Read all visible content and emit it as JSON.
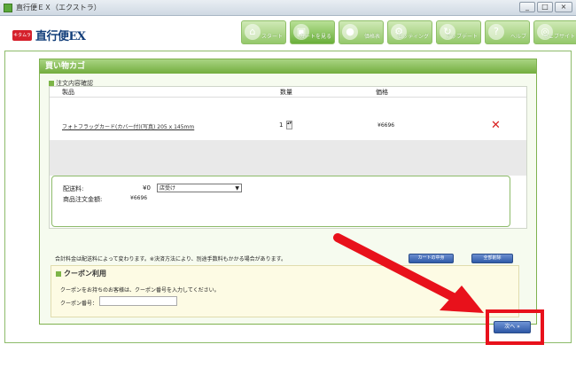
{
  "window": {
    "title": "直行便ＥＸ（エクストラ）",
    "minimize_glyph": "_",
    "maximize_glyph": "□",
    "close_glyph": "×"
  },
  "logo": {
    "badge": "キタムラ",
    "text": "直行便EX"
  },
  "nav": {
    "items": [
      {
        "label": "スタート",
        "icon": "house-icon",
        "glyph": "⌂"
      },
      {
        "label": "カートを見る",
        "icon": "cart-icon",
        "glyph": "▣"
      },
      {
        "label": "価格表",
        "icon": "price-list-icon",
        "glyph": "●"
      },
      {
        "label": "セッティング",
        "icon": "settings-icon",
        "glyph": "⚙"
      },
      {
        "label": "アップデート",
        "icon": "update-icon",
        "glyph": "↻"
      },
      {
        "label": "ヘルプ",
        "icon": "help-icon",
        "glyph": "?"
      },
      {
        "label": "ウェブサイト",
        "icon": "website-icon",
        "glyph": "◎"
      }
    ]
  },
  "cart": {
    "title": "買い物カゴ",
    "order_section": "注文内容確認",
    "columns": {
      "product": "製品",
      "quantity": "数量",
      "price": "価格"
    },
    "items": [
      {
        "product": "フォトフラッグカード(カバー付)(写真) 205 x 145mm",
        "quantity": "1",
        "price": "¥6696",
        "spin": "▴▾"
      }
    ],
    "delete_glyph": "✕",
    "shipping_label": "配送料:",
    "shipping_value": "¥0",
    "shipping_method": "店受け",
    "select_arrow": "▼",
    "total_label": "商品注文金額:",
    "total_value": "¥6696",
    "note": "合計料金は配送料によって変わります。※決済方法により、別途手数料もかかる場合があります。",
    "button_continue": "カートの中身",
    "button_clear": "全部削除"
  },
  "coupon": {
    "title": "クーポン利用",
    "description": "クーポンをお持ちのお客様は、クーポン番号を入力してください。",
    "label": "クーポン番号：",
    "value": ""
  },
  "footer": {
    "next_label": "次へ »"
  },
  "colors": {
    "accent_green": "#73ad3e",
    "annotation_red": "#e8111b",
    "button_blue": "#2e58a6"
  }
}
